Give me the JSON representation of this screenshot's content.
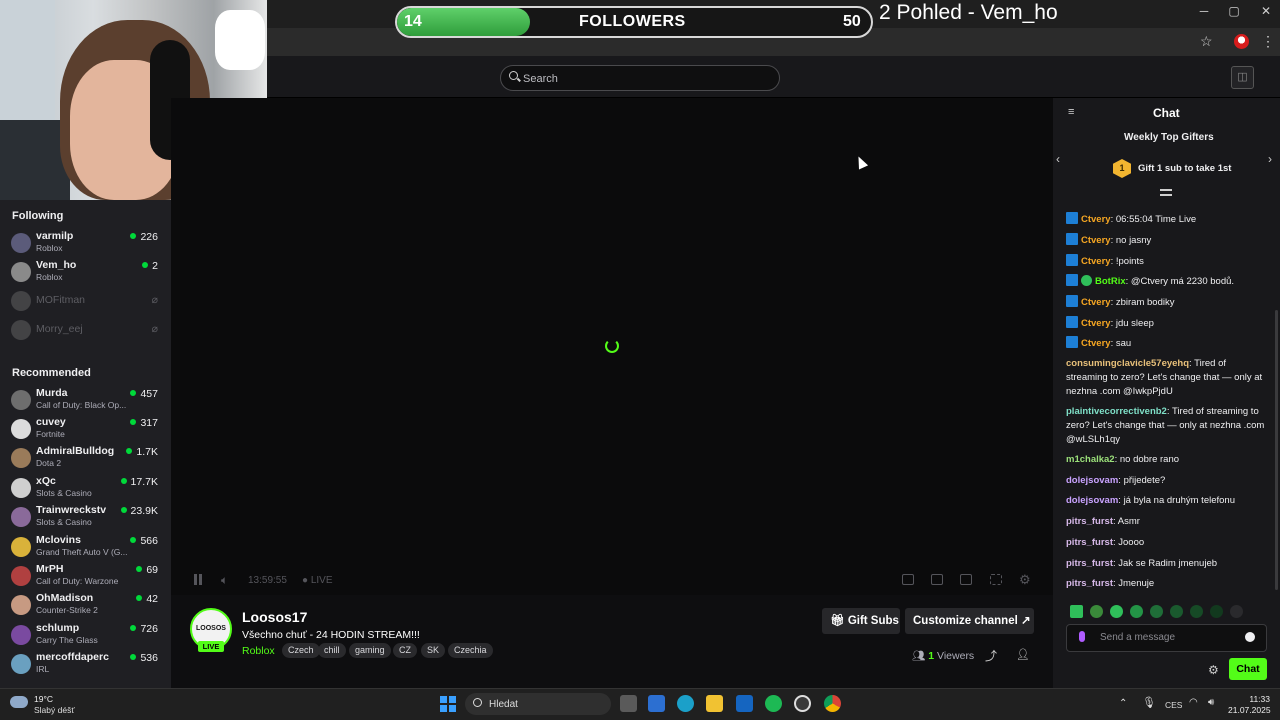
{
  "window": {
    "title": "2 Pohled - Vem_ho",
    "minimize": "─",
    "maximize": "▢",
    "close": "✕"
  },
  "followers_goal": {
    "current": "14",
    "label": "FOLLOWERS",
    "goal": "50",
    "progress_fraction": 0.28,
    "fill_color": "#3fb34a"
  },
  "header": {
    "search_placeholder": "Search",
    "avatar_icon": "user-icon"
  },
  "sidebar": {
    "following_title": "Following",
    "following": [
      {
        "name": "varmilp",
        "game": "Roblox",
        "viewers": "226",
        "live": true
      },
      {
        "name": "Vem_ho",
        "game": "Roblox",
        "viewers": "2",
        "live": true
      },
      {
        "name": "MOFitman",
        "game": "",
        "viewers": "",
        "live": false
      },
      {
        "name": "Morry_eej",
        "game": "",
        "viewers": "",
        "live": false
      }
    ],
    "recommended_title": "Recommended",
    "recommended": [
      {
        "name": "Murda",
        "game": "Call of Duty: Black Op...",
        "viewers": "457"
      },
      {
        "name": "cuvey",
        "game": "Fortnite",
        "viewers": "317"
      },
      {
        "name": "AdmiralBulldog",
        "game": "Dota 2",
        "viewers": "1.7K"
      },
      {
        "name": "xQc",
        "game": "Slots & Casino",
        "viewers": "17.7K"
      },
      {
        "name": "Trainwreckstv",
        "game": "Slots & Casino",
        "viewers": "23.9K"
      },
      {
        "name": "Mclovins",
        "game": "Grand Theft Auto V (G...",
        "viewers": "566"
      },
      {
        "name": "MrPH",
        "game": "Call of Duty: Warzone",
        "viewers": "69"
      },
      {
        "name": "OhMadison",
        "game": "Counter-Strike 2",
        "viewers": "42"
      },
      {
        "name": "schlump",
        "game": "Carry The Glass",
        "viewers": "726"
      },
      {
        "name": "mercoffdaperc",
        "game": "IRL",
        "viewers": "536"
      }
    ]
  },
  "player": {
    "elapsed": "13:59:55",
    "live_label": "LIVE"
  },
  "stream": {
    "channel": "Loosos17",
    "avatar_text": "LOOSOS",
    "live_badge": "LIVE",
    "title": "Všechno chuť - 24 HODIN STREAM!!!",
    "category": "Roblox",
    "tags": [
      "Czech",
      "chill",
      "gaming",
      "CZ",
      "SK",
      "Czechia"
    ],
    "gift_subs_label": "Gift Subs",
    "customize_label": "Customize channel",
    "viewers_count": "1",
    "viewers_label": "Viewers"
  },
  "chat": {
    "title": "Chat",
    "top_gifters_title": "Weekly Top Gifters",
    "gift_rank": "1",
    "gift_cta": "Gift 1 sub to take 1st",
    "messages": [
      {
        "user": "Ctvery",
        "text": "06:55:04 Time Live",
        "color": "#f5a623",
        "badge": true
      },
      {
        "user": "Ctvery",
        "text": "no jasny",
        "color": "#f5a623",
        "badge": true
      },
      {
        "user": "Ctvery",
        "text": "!points",
        "color": "#f5a623",
        "badge": true
      },
      {
        "user": "BotRix",
        "text": "@Ctvery má 2230 bodů.",
        "color": "#53fc18",
        "badge": true,
        "verified": true
      },
      {
        "user": "Ctvery",
        "text": "zbiram bodiky",
        "color": "#f5a623",
        "badge": true
      },
      {
        "user": "Ctvery",
        "text": "jdu sleep",
        "color": "#f5a623",
        "badge": true
      },
      {
        "user": "Ctvery",
        "text": "sau",
        "color": "#f5a623",
        "badge": true
      },
      {
        "user": "consumingclavicle57eyehq",
        "text": "Tired of streaming to zero? Let's change that — only at nezhna .com @IwkpPjdU",
        "color": "#e8c07a"
      },
      {
        "user": "plaintivecorrectivenb2",
        "text": "Tired of streaming to zero? Let's change that — only at nezhna .com @wLSLh1qy",
        "color": "#7fe0c8"
      },
      {
        "user": "m1chalka2",
        "text": "no dobre rano",
        "color": "#9be07a"
      },
      {
        "user": "dolejsovam",
        "text": "přijedete?",
        "color": "#c9a3ff"
      },
      {
        "user": "dolejsovam",
        "text": "já byla na druhým telefonu",
        "color": "#c9a3ff"
      },
      {
        "user": "pitrs_furst",
        "text": "Asmr",
        "color": "#d6b8e8"
      },
      {
        "user": "pitrs_furst",
        "text": "Joooo",
        "color": "#d6b8e8"
      },
      {
        "user": "pitrs_furst",
        "text": "Jak se Radim jmenujeb",
        "color": "#d6b8e8"
      },
      {
        "user": "pitrs_furst",
        "text": "Jmenuje",
        "color": "#d6b8e8"
      }
    ],
    "input_placeholder": "Send a message",
    "send_label": "Chat"
  },
  "taskbar": {
    "weather_temp": "19°C",
    "weather_desc": "Slabý déšť",
    "search_label": "Hledat",
    "language": "CES",
    "time": "11:33",
    "date": "21.07.2025"
  }
}
